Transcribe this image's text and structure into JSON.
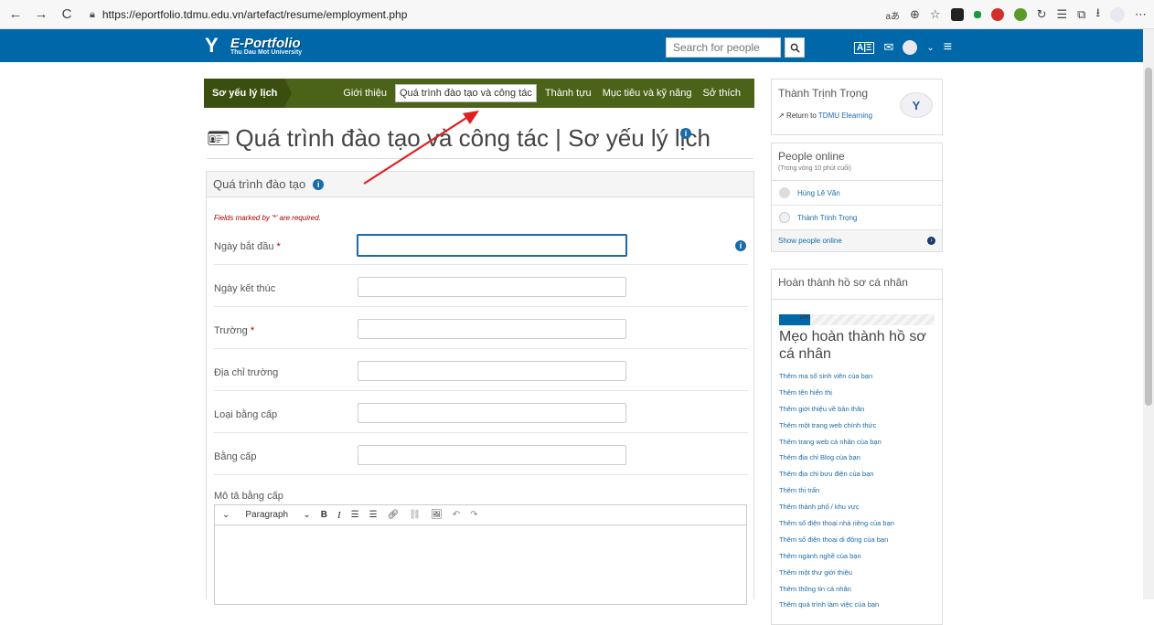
{
  "browser": {
    "url": "https://eportfolio.tdmu.edu.vn/artefact/resume/employment.php",
    "back": "←",
    "forward": "→",
    "reload": "C",
    "tools_text": "aあ",
    "zoom": "⊕"
  },
  "header": {
    "logo_title": "E-Portfolio",
    "logo_sub": "Thu Dau Mot University",
    "search_placeholder": "Search for people"
  },
  "subnav": {
    "title": "Sơ yếu lý lịch",
    "tabs": [
      {
        "label": "Giới thiệu"
      },
      {
        "label": "Quá trình đào tạo và công tác"
      },
      {
        "label": "Thành tựu"
      },
      {
        "label": "Mục tiêu và kỹ năng"
      },
      {
        "label": "Sở thích"
      }
    ]
  },
  "page": {
    "title": "Quá trình đào tạo và công tác | Sơ yếu lý lịch"
  },
  "form": {
    "section_title": "Quá trình đào tạo",
    "required_note": "Fields marked by '*' are required.",
    "fields": [
      {
        "label": "Ngày bắt đầu",
        "required": "*"
      },
      {
        "label": "Ngày kết thúc",
        "required": ""
      },
      {
        "label": "Trường",
        "required": "*"
      },
      {
        "label": "Địa chỉ trường",
        "required": ""
      },
      {
        "label": "Loại bằng cấp",
        "required": ""
      },
      {
        "label": "Bằng cấp",
        "required": ""
      }
    ],
    "desc_label": "Mô tả bằng cấp",
    "editor_paragraph": "Paragraph"
  },
  "sidebar": {
    "user_name": "Thành Trịnh Trọng",
    "return_prefix": "Return to",
    "return_link": "TDMU Elearning",
    "online_title": "People online",
    "online_sub": "(Trong vòng 10 phút cuối)",
    "people": [
      {
        "name": "Hùng Lê Văn"
      },
      {
        "name": "Thành Trịnh Trọng"
      }
    ],
    "show_online": "Show people online",
    "profile_title": "Hoàn thành hồ sơ cá nhân",
    "progress_percent": 10,
    "progress_label": "10%",
    "tips_title": "Mẹo hoàn thành hồ sơ cá nhân",
    "tips": [
      "Thêm ma số sinh viên của bạn",
      "Thêm tên hiển thị",
      "Thêm giới thiệu về bản thân",
      "Thêm một trang web chính thức",
      "Thêm trang web cá nhân của bạn",
      "Thêm địa chỉ Blog của bạn",
      "Thêm địa chỉ bưu điện của bạn",
      "Thêm thị trấn",
      "Thêm thành phố / khu vực",
      "Thêm số điện thoại nhà riêng của bạn",
      "Thêm số điện thoại di động của bạn",
      "Thêm ngành nghề của bạn",
      "Thêm một thư giới thiệu",
      "Thêm thông tin cá nhân",
      "Thêm quá trình làm việc của bạn"
    ]
  },
  "colors": {
    "header_blue": "#0068a8",
    "subnav_green": "#4b6319",
    "link_blue": "#1a6ba8",
    "annotation_red": "#e02020"
  }
}
